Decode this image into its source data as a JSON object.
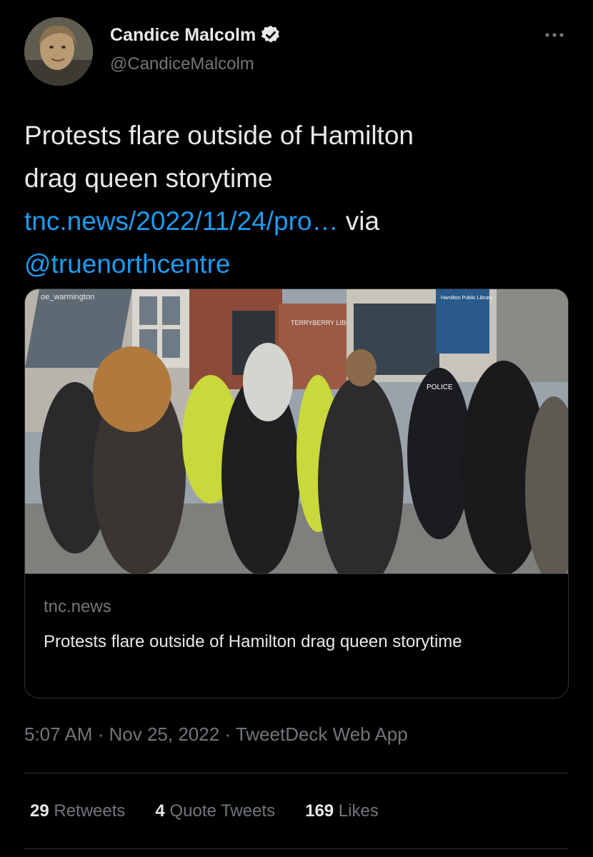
{
  "author": {
    "name": "Candice Malcolm",
    "handle": "@CandiceMalcolm"
  },
  "tweet": {
    "text_line1": "Protests flare outside of Hamilton",
    "text_line2": "drag queen storytime",
    "link": "tnc.news/2022/11/24/pro…",
    "via": " via",
    "mention": "@truenorthcentre"
  },
  "card": {
    "image_alt": "Protesters and police outside Terryberry Library",
    "image_watermark": "oe_warmington",
    "sign_library": "TERRYBERRY LIBRARY",
    "sign_hamilton": "Hamilton Public Library",
    "vest_label": "POLICE",
    "domain": "tnc.news",
    "title": "Protests flare outside of Hamilton drag queen storytime"
  },
  "meta": {
    "time": "5:07 AM",
    "separator": " · ",
    "date": "Nov 25, 2022",
    "source": "TweetDeck Web App"
  },
  "stats": {
    "retweets_count": "29",
    "retweets_label": " Retweets",
    "quotes_count": "4",
    "quotes_label": " Quote Tweets",
    "likes_count": "169",
    "likes_label": " Likes"
  },
  "colors": {
    "background": "#000000",
    "text": "#e7e9ea",
    "secondary": "#71767b",
    "link": "#1d9bf0",
    "border": "#2f3336"
  }
}
